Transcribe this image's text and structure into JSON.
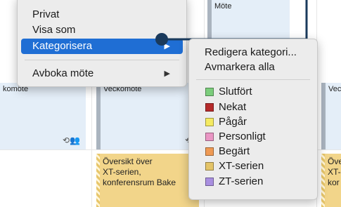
{
  "calendar": {
    "events": [
      {
        "title": "Möte"
      },
      {
        "title": "komöte"
      },
      {
        "title": "Veckomöte"
      },
      {
        "title": "Vec"
      },
      {
        "lines": [
          "Översikt över",
          "XT-serien,",
          "konferensrum Bake"
        ]
      },
      {
        "lines": [
          "Över",
          "XT-",
          "kor"
        ]
      }
    ]
  },
  "context_menu": {
    "items": [
      {
        "label": "Privat"
      },
      {
        "label": "Visa som"
      },
      {
        "label": "Kategorisera",
        "arrow": "▶"
      },
      {
        "label": "Avboka möte",
        "arrow": "▶"
      }
    ]
  },
  "submenu": {
    "edit": "Redigera kategori...",
    "clear": "Avmarkera alla",
    "categories": [
      {
        "label": "Slutfört",
        "color": "#7ccd7c"
      },
      {
        "label": "Nekat",
        "color": "#b52a2a"
      },
      {
        "label": "Pågår",
        "color": "#f5ea61"
      },
      {
        "label": "Personligt",
        "color": "#ea96c4"
      },
      {
        "label": "Begärt",
        "color": "#ef9a54"
      },
      {
        "label": "XT-serien",
        "color": "#e4c468"
      },
      {
        "label": "ZT-serien",
        "color": "#a98fe0"
      }
    ]
  },
  "colors": {
    "highlight": "#1f6ed4",
    "callout": "#1a3a5c"
  }
}
